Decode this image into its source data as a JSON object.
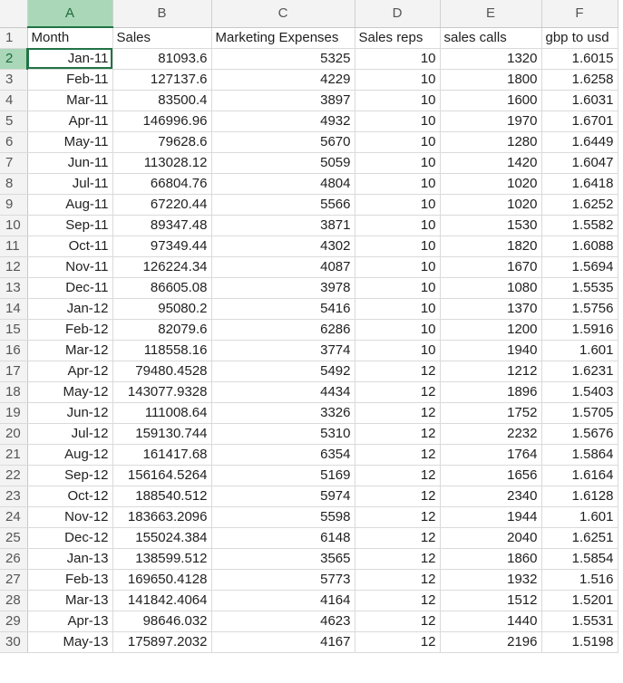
{
  "columns": [
    "A",
    "B",
    "C",
    "D",
    "E",
    "F"
  ],
  "headers": [
    "Month",
    "Sales",
    "Marketing Expenses",
    "Sales reps",
    "sales calls",
    "gbp to usd"
  ],
  "rows": [
    [
      "Jan-11",
      "81093.6",
      "5325",
      "10",
      "1320",
      "1.6015"
    ],
    [
      "Feb-11",
      "127137.6",
      "4229",
      "10",
      "1800",
      "1.6258"
    ],
    [
      "Mar-11",
      "83500.4",
      "3897",
      "10",
      "1600",
      "1.6031"
    ],
    [
      "Apr-11",
      "146996.96",
      "4932",
      "10",
      "1970",
      "1.6701"
    ],
    [
      "May-11",
      "79628.6",
      "5670",
      "10",
      "1280",
      "1.6449"
    ],
    [
      "Jun-11",
      "113028.12",
      "5059",
      "10",
      "1420",
      "1.6047"
    ],
    [
      "Jul-11",
      "66804.76",
      "4804",
      "10",
      "1020",
      "1.6418"
    ],
    [
      "Aug-11",
      "67220.44",
      "5566",
      "10",
      "1020",
      "1.6252"
    ],
    [
      "Sep-11",
      "89347.48",
      "3871",
      "10",
      "1530",
      "1.5582"
    ],
    [
      "Oct-11",
      "97349.44",
      "4302",
      "10",
      "1820",
      "1.6088"
    ],
    [
      "Nov-11",
      "126224.34",
      "4087",
      "10",
      "1670",
      "1.5694"
    ],
    [
      "Dec-11",
      "86605.08",
      "3978",
      "10",
      "1080",
      "1.5535"
    ],
    [
      "Jan-12",
      "95080.2",
      "5416",
      "10",
      "1370",
      "1.5756"
    ],
    [
      "Feb-12",
      "82079.6",
      "6286",
      "10",
      "1200",
      "1.5916"
    ],
    [
      "Mar-12",
      "118558.16",
      "3774",
      "10",
      "1940",
      "1.601"
    ],
    [
      "Apr-12",
      "79480.4528",
      "5492",
      "12",
      "1212",
      "1.6231"
    ],
    [
      "May-12",
      "143077.9328",
      "4434",
      "12",
      "1896",
      "1.5403"
    ],
    [
      "Jun-12",
      "111008.64",
      "3326",
      "12",
      "1752",
      "1.5705"
    ],
    [
      "Jul-12",
      "159130.744",
      "5310",
      "12",
      "2232",
      "1.5676"
    ],
    [
      "Aug-12",
      "161417.68",
      "6354",
      "12",
      "1764",
      "1.5864"
    ],
    [
      "Sep-12",
      "156164.5264",
      "5169",
      "12",
      "1656",
      "1.6164"
    ],
    [
      "Oct-12",
      "188540.512",
      "5974",
      "12",
      "2340",
      "1.6128"
    ],
    [
      "Nov-12",
      "183663.2096",
      "5598",
      "12",
      "1944",
      "1.601"
    ],
    [
      "Dec-12",
      "155024.384",
      "6148",
      "12",
      "2040",
      "1.6251"
    ],
    [
      "Jan-13",
      "138599.512",
      "3565",
      "12",
      "1860",
      "1.5854"
    ],
    [
      "Feb-13",
      "169650.4128",
      "5773",
      "12",
      "1932",
      "1.516"
    ],
    [
      "Mar-13",
      "141842.4064",
      "4164",
      "12",
      "1512",
      "1.5201"
    ],
    [
      "Apr-13",
      "98646.032",
      "4623",
      "12",
      "1440",
      "1.5531"
    ],
    [
      "May-13",
      "175897.2032",
      "4167",
      "12",
      "2196",
      "1.5198"
    ]
  ],
  "selected_column": "A",
  "selected_row": "2"
}
